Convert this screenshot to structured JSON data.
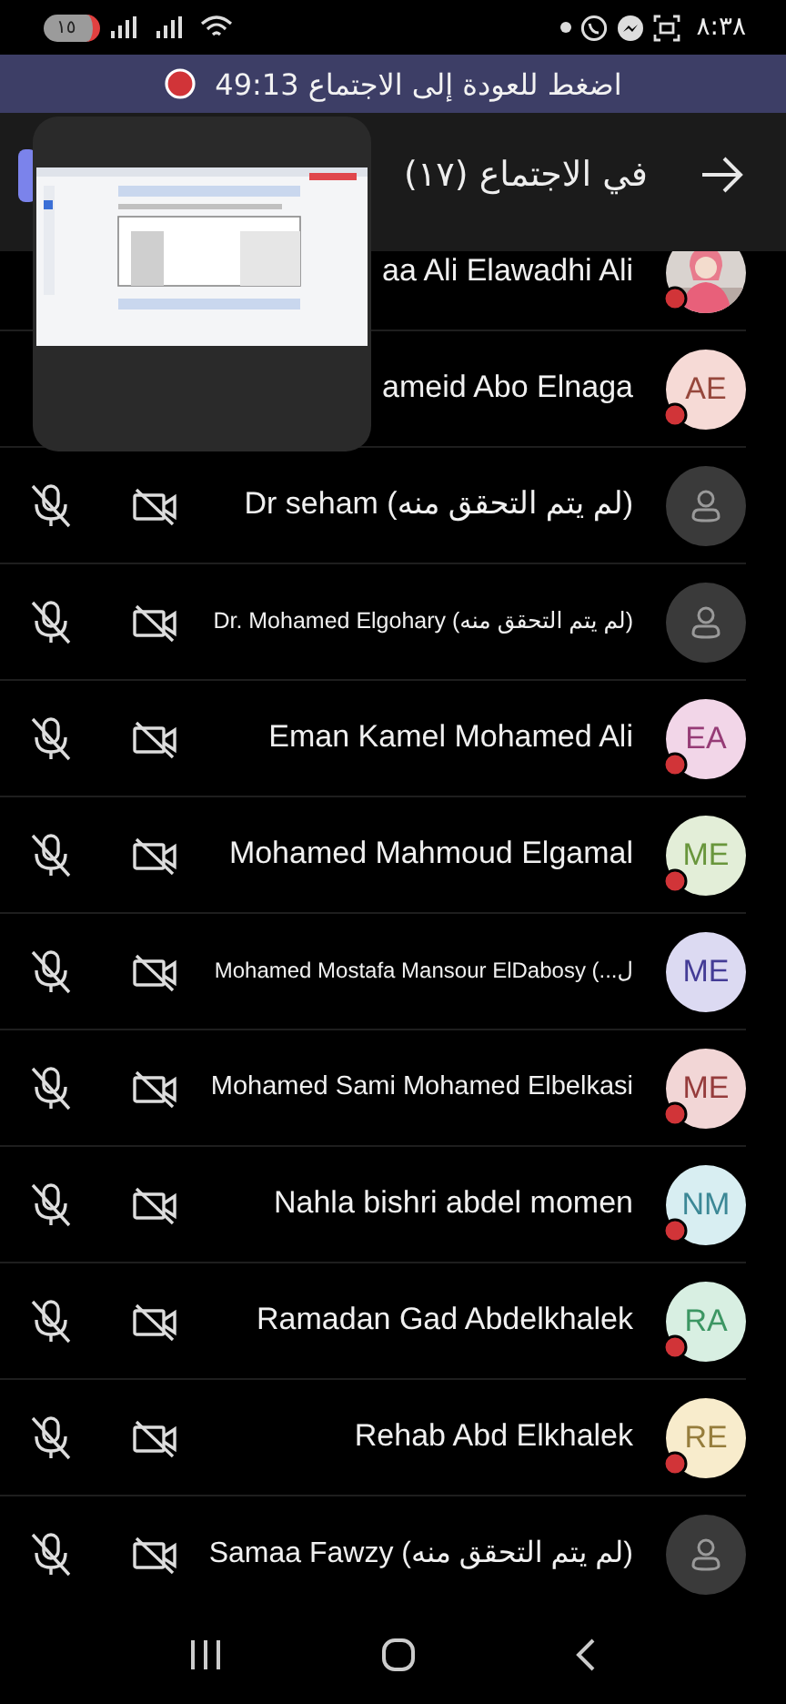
{
  "status_bar": {
    "battery": "١٥",
    "time": "٨:٣٨"
  },
  "banner": {
    "text": "اضغط للعودة إلى الاجتماع 49:13",
    "recording": true
  },
  "header": {
    "title": "في الاجتماع (١٧)"
  },
  "participants": [
    {
      "name": "aa Ali Elawadhi Ali",
      "busy": true
    },
    {
      "name": "ameid Abo Elnaga",
      "avatar": {
        "kind": "initials",
        "initials": "AE",
        "color": "#f6dad6"
      },
      "busy": true
    },
    {
      "name": "Dr seham  (لم يتم التحقق منه)",
      "avatar": {
        "kind": "placeholder"
      },
      "busy": false,
      "mic_off": true,
      "camera_off": true
    },
    {
      "name": "Dr. Mohamed Elgohary (لم يتم التحقق منه)",
      "avatar": {
        "kind": "placeholder"
      },
      "busy": false,
      "mic_off": true,
      "camera_off": true
    },
    {
      "name": "Eman Kamel Mohamed Ali",
      "avatar": {
        "kind": "initials",
        "initials": "EA",
        "color": "#f2d6e8"
      },
      "busy": true,
      "mic_off": true,
      "camera_off": true
    },
    {
      "name": "Mohamed Mahmoud Elgamal",
      "avatar": {
        "kind": "initials",
        "initials": "ME",
        "color": "#e3eed8"
      },
      "busy": true,
      "mic_off": true,
      "camera_off": true
    },
    {
      "name": "Mohamed Mostafa Mansour ElDabosy (...ل",
      "avatar": {
        "kind": "initials",
        "initials": "ME",
        "color": "#dcdaf2"
      },
      "busy": false,
      "mic_off": true,
      "camera_off": true
    },
    {
      "name": "Mohamed Sami Mohamed Elbelkasi",
      "avatar": {
        "kind": "initials",
        "initials": "ME",
        "color": "#f2d6d6"
      },
      "busy": true,
      "mic_off": true,
      "camera_off": true
    },
    {
      "name": "Nahla bishri abdel momen",
      "avatar": {
        "kind": "initials",
        "initials": "NM",
        "color": "#d8eef2"
      },
      "busy": true,
      "mic_off": true,
      "camera_off": true
    },
    {
      "name": "Ramadan Gad Abdelkhalek",
      "avatar": {
        "kind": "initials",
        "initials": "RA",
        "color": "#d8efe2"
      },
      "busy": true,
      "mic_off": true,
      "camera_off": true
    },
    {
      "name": "Rehab Abd Elkhalek",
      "avatar": {
        "kind": "initials",
        "initials": "RE",
        "color": "#f8eccc"
      },
      "busy": true,
      "mic_off": true,
      "camera_off": true
    },
    {
      "name": "Samaa Fawzy (لم يتم التحقق منه)",
      "avatar": {
        "kind": "placeholder"
      },
      "busy": false,
      "mic_off": true,
      "camera_off": true
    }
  ]
}
